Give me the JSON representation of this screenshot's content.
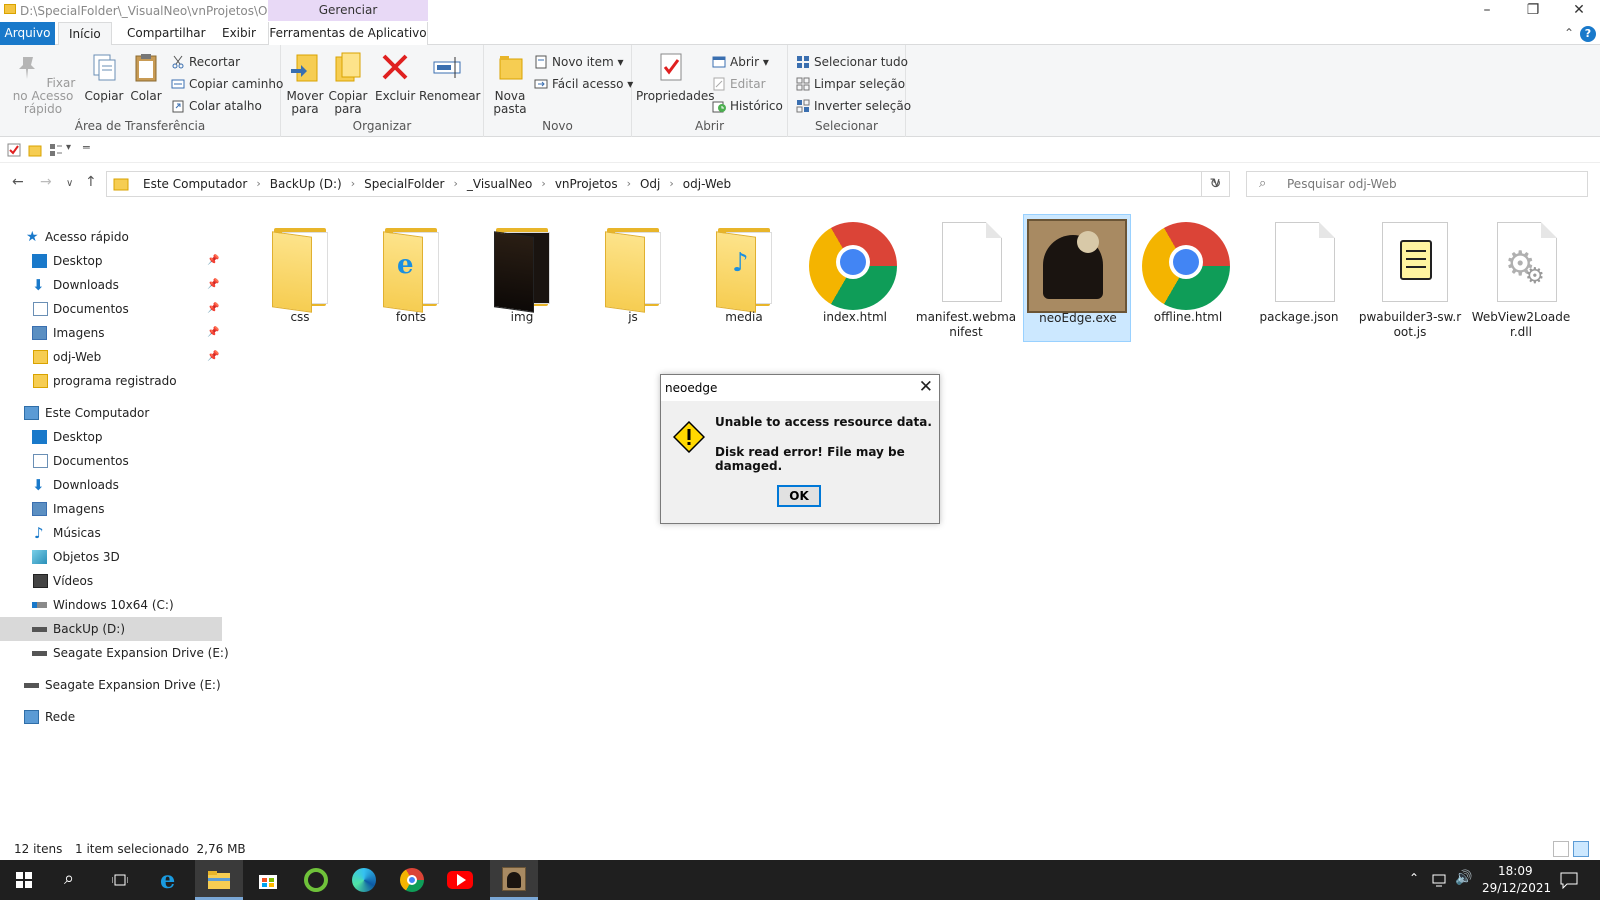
{
  "window": {
    "title": "D:\\SpecialFolder\\_VisualNeo\\vnProjetos\\Odj...",
    "context_tab": "Gerenciar"
  },
  "menu": {
    "tabs": [
      "Arquivo",
      "Início",
      "Compartilhar",
      "Exibir",
      "Ferramentas de Aplicativo"
    ]
  },
  "ribbon": {
    "clipboard": {
      "label": "Área de Transferência",
      "pin": "Fixar no Acesso rápido",
      "copy": "Copiar",
      "paste": "Colar",
      "cut": "Recortar",
      "copy_path": "Copiar caminho",
      "paste_shortcut": "Colar atalho"
    },
    "organize": {
      "label": "Organizar",
      "move_to": "Mover para",
      "copy_to": "Copiar para",
      "delete": "Excluir",
      "rename": "Renomear"
    },
    "new": {
      "label": "Novo",
      "new_folder": "Nova pasta",
      "new_item": "Novo item",
      "easy_access": "Fácil acesso"
    },
    "open": {
      "label": "Abrir",
      "properties": "Propriedades",
      "open": "Abrir",
      "edit": "Editar",
      "history": "Histórico"
    },
    "select": {
      "label": "Selecionar",
      "select_all": "Selecionar tudo",
      "select_none": "Limpar seleção",
      "invert": "Inverter seleção"
    }
  },
  "address": {
    "crumbs": [
      "Este Computador",
      "BackUp (D:)",
      "SpecialFolder",
      "_VisualNeo",
      "vnProjetos",
      "Odj",
      "odj-Web"
    ],
    "search_placeholder": "Pesquisar odj-Web"
  },
  "nav": {
    "quick_access": "Acesso rápido",
    "quick_items": [
      "Desktop",
      "Downloads",
      "Documentos",
      "Imagens",
      "odj-Web",
      "programa registrado"
    ],
    "this_pc": "Este Computador",
    "pc_items": [
      "Desktop",
      "Documentos",
      "Downloads",
      "Imagens",
      "Músicas",
      "Objetos 3D",
      "Vídeos",
      "Windows 10x64 (C:)",
      "BackUp (D:)",
      "Seagate Expansion Drive (E:)"
    ],
    "drive": "Seagate Expansion Drive (E:)",
    "network": "Rede"
  },
  "files": [
    {
      "name": "css",
      "icon": "folder-icon"
    },
    {
      "name": "fonts",
      "icon": "folder-icon"
    },
    {
      "name": "img",
      "icon": "folder-icon"
    },
    {
      "name": "js",
      "icon": "folder-icon"
    },
    {
      "name": "media",
      "icon": "folder-icon"
    },
    {
      "name": "index.html",
      "icon": "chrome-icon"
    },
    {
      "name": "manifest.webmanifest",
      "icon": "file-icon"
    },
    {
      "name": "neoEdge.exe",
      "icon": "app-icon"
    },
    {
      "name": "offline.html",
      "icon": "chrome-icon"
    },
    {
      "name": "package.json",
      "icon": "file-icon"
    },
    {
      "name": "pwabuilder3-sw.root.js",
      "icon": "script-icon"
    },
    {
      "name": "WebView2Loader.dll",
      "icon": "dll-icon"
    }
  ],
  "dialog": {
    "title": "neoedge",
    "message1": "Unable to access resource data.",
    "message2": "Disk read error! File may be damaged.",
    "ok": "OK"
  },
  "status": {
    "count": "12 itens",
    "selection": "1 item selecionado  2,76 MB"
  },
  "taskbar": {
    "time": "18:09",
    "date": "29/12/2021"
  },
  "colors": {
    "accent": "#1979ca",
    "context_tab": "#e8d9f6",
    "selection": "#cce8ff",
    "taskbar": "#1f1f1f"
  }
}
